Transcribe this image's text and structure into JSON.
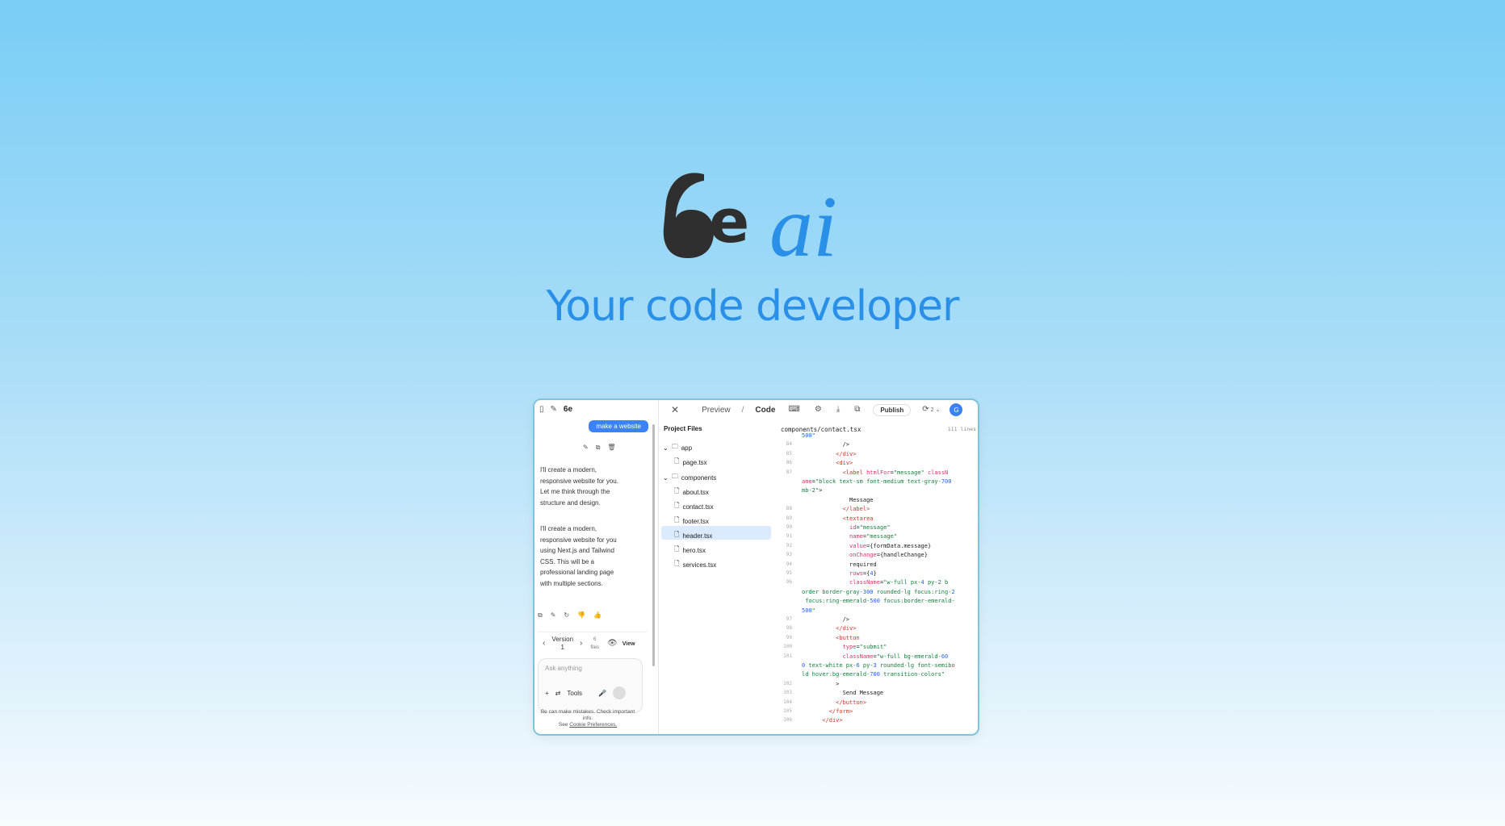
{
  "hero": {
    "logo_mark": "6",
    "logo_e": "e",
    "logo_ai": "ai",
    "tagline": "Your code developer"
  },
  "toolbar": {
    "preview": "Preview",
    "separator": "/",
    "code": "Code",
    "publish": "Publish",
    "version_count": "2",
    "avatar": "G"
  },
  "chat": {
    "user_message": "make a website",
    "ai_messages": [
      "I'll create a modern, responsive website for you. Let me think through the structure and design.",
      "I'll create a modern, responsive website for you using Next.js and Tailwind CSS. This will be a professional landing page with multiple sections."
    ],
    "version_label": "Version",
    "version_num": "1",
    "files_count": "6",
    "files_label": "files",
    "view": "View",
    "input_placeholder": "Ask anything",
    "tools": "Tools",
    "disclaimer": "Be can make mistakes. Check important info.",
    "see": "See",
    "cookie": "Cookie Preferences."
  },
  "files": {
    "title": "Project Files",
    "items": [
      "app",
      "page.tsx",
      "components",
      "about.tsx",
      "contact.tsx",
      "footer.tsx",
      "header.tsx",
      "hero.tsx",
      "services.tsx"
    ]
  },
  "code": {
    "path": "components/contact.tsx",
    "meta": "111 lines",
    "line_numbers": [
      "84",
      "85",
      "86",
      "87",
      "88",
      "89",
      "90",
      "91",
      "92",
      "93",
      "94",
      "95",
      "96",
      "97",
      "98",
      "99",
      "100",
      "101",
      "102",
      "103",
      "104",
      "105",
      "106"
    ]
  }
}
